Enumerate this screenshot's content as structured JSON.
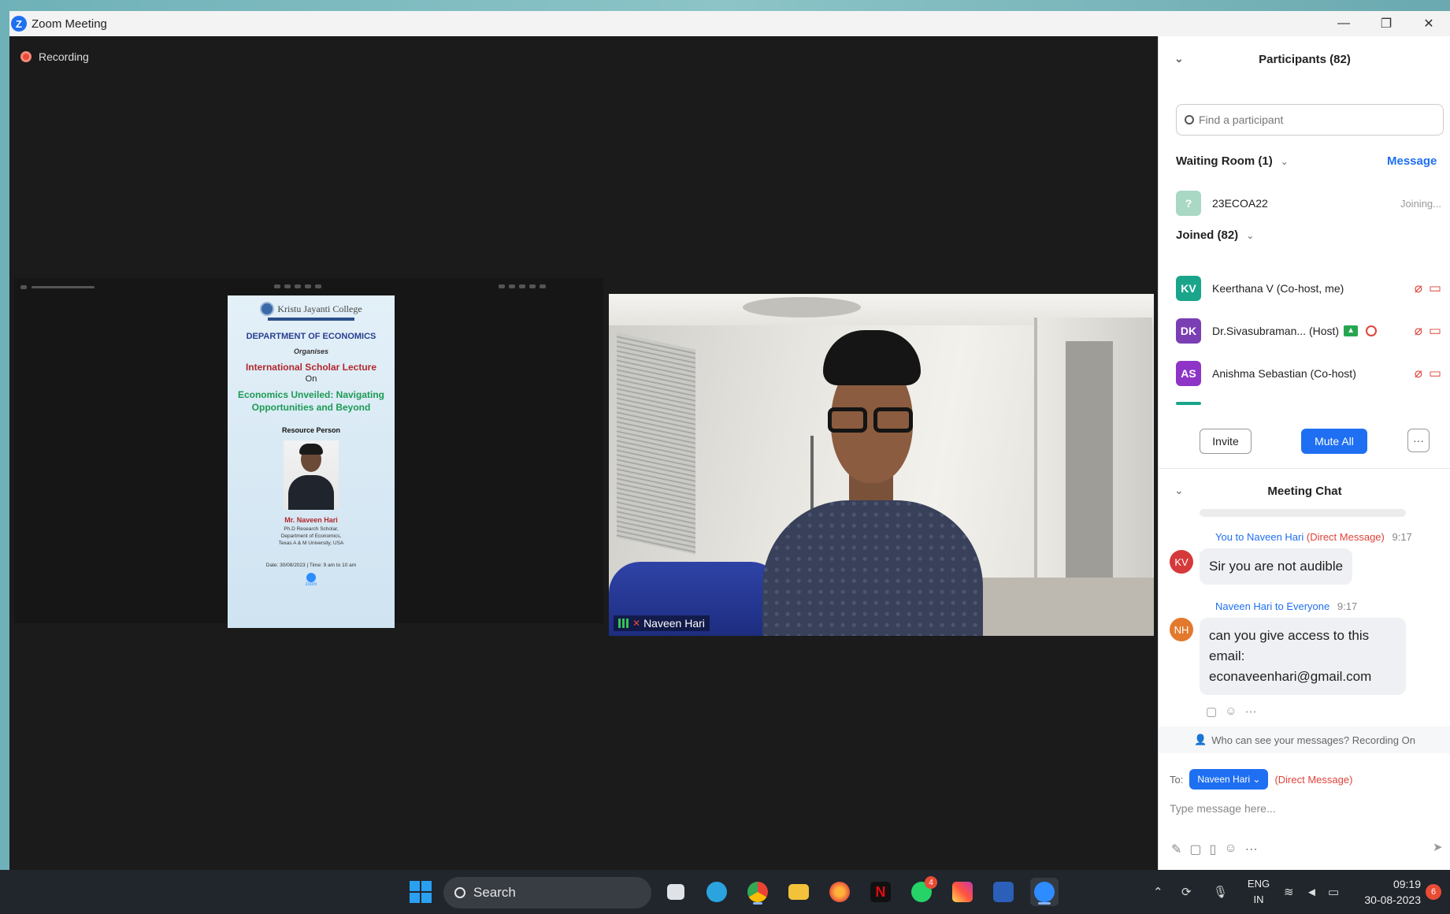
{
  "window": {
    "title": "Zoom Meeting",
    "controls": [
      "—",
      "❐",
      "✕"
    ]
  },
  "meeting": {
    "recording_label": "Recording"
  },
  "poster": {
    "college": "Kristu Jayanti College",
    "department": "DEPARTMENT OF ECONOMICS",
    "organises": "Organises",
    "lecture": "International Scholar Lecture",
    "on": "On",
    "topic_line1": "Economics Unveiled: Navigating",
    "topic_line2": "Opportunities and Beyond",
    "resource_person_label": "Resource Person",
    "person_name": "Mr. Naveen Hari",
    "person_desc_1": "Ph.D Research Scholar,",
    "person_desc_2": "Department of Economics,",
    "person_desc_3": "Texas A & M University, USA",
    "date_time": "Date: 30/08/2023 | Time: 9 am to 10 am",
    "zoom_label": "zoom"
  },
  "camera": {
    "participant_name": "Naveen Hari"
  },
  "participants": {
    "header": "Participants (82)",
    "search_placeholder": "Find a participant",
    "waiting_room_label": "Waiting Room (1)",
    "message_link": "Message",
    "waiting": [
      {
        "initials": "?",
        "name": "23ECOA22",
        "status": "Joining...",
        "color": "#a9d8c4"
      }
    ],
    "joined_label": "Joined (82)",
    "joined": [
      {
        "initials": "KV",
        "name": "Keerthana V (Co-host, me)",
        "color": "#1aa58b"
      },
      {
        "initials": "DK",
        "name": "Dr.Sivasubraman... (Host)",
        "color": "#7b3fb4"
      },
      {
        "initials": "AS",
        "name": "Anishma Sebastian (Co-host)",
        "color": "#8e35c7"
      }
    ],
    "invite_label": "Invite",
    "mute_all_label": "Mute All",
    "more_label": "···"
  },
  "chat": {
    "header": "Meeting Chat",
    "messages": [
      {
        "avatar": "KV",
        "avatar_color": "#d6393a",
        "sender": "You to Naveen Hari",
        "tag": "(Direct Message)",
        "time": "9:17",
        "text": "Sir you are not audible"
      },
      {
        "avatar": "NH",
        "avatar_color": "#e2792d",
        "sender": "Naveen Hari to Everyone",
        "tag": "",
        "time": "9:17",
        "text_line1": "can you give access to this",
        "text_line2": "email:",
        "text_line3": "econaveenhari@gmail.com"
      }
    ],
    "privacy_notice": "Who can see your messages? Recording On",
    "to_label": "To:",
    "to_recipient": "Naveen Hari ⌄",
    "to_tag": "(Direct Message)",
    "input_placeholder": "Type message here..."
  },
  "taskbar": {
    "search_label": "Search",
    "whatsapp_badge": "4",
    "language_1": "ENG",
    "language_2": "IN",
    "time": "09:19",
    "date": "30-08-2023",
    "notification_count": "6"
  }
}
